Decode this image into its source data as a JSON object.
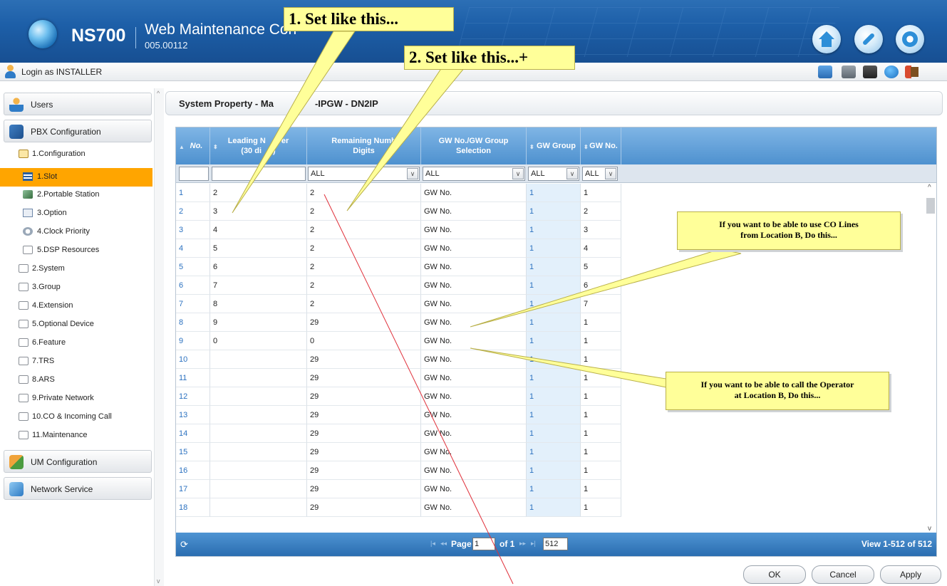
{
  "header": {
    "product": "NS700",
    "app_title": "Web Maintenance Con",
    "version": "005.00112",
    "login_label": "Login as INSTALLER",
    "top_icons": [
      "home-icon",
      "wrench-icon",
      "gear-icon"
    ],
    "toolbar_icons": [
      "calendar-icon",
      "phone-icon",
      "save-icon",
      "info-icon",
      "exit-icon"
    ]
  },
  "sidebar": {
    "sections": [
      {
        "label": "Users",
        "icon": "users-icon"
      },
      {
        "label": "PBX Configuration",
        "icon": "pbx-icon"
      },
      {
        "label": "UM Configuration",
        "icon": "um-icon"
      },
      {
        "label": "Network Service",
        "icon": "network-icon"
      }
    ],
    "tree": [
      {
        "label": "1.Configuration"
      },
      {
        "label": "1.Slot"
      },
      {
        "label": "2.Portable Station"
      },
      {
        "label": "3.Option"
      },
      {
        "label": "4.Clock Priority"
      },
      {
        "label": "5.DSP Resources"
      },
      {
        "label": "2.System"
      },
      {
        "label": "3.Group"
      },
      {
        "label": "4.Extension"
      },
      {
        "label": "5.Optional Device"
      },
      {
        "label": "6.Feature"
      },
      {
        "label": "7.TRS"
      },
      {
        "label": "8.ARS"
      },
      {
        "label": "9.Private Network"
      },
      {
        "label": "10.CO & Incoming Call"
      },
      {
        "label": "11.Maintenance"
      }
    ]
  },
  "main": {
    "title": "System Property - Ma",
    "title_tail": "-IPGW - DN2IP"
  },
  "grid": {
    "columns": [
      {
        "label": "No.",
        "sort": "▲"
      },
      {
        "label": "Leading N",
        "label2": "er",
        "sub": "(30 di",
        "sub2": ")",
        "sort": "⬍"
      },
      {
        "label": "Remaining Numb",
        "sub": "Digits",
        "sort": ""
      },
      {
        "label": "GW No./GW Group",
        "sub": "Selection",
        "sort": ""
      },
      {
        "label": "GW Group",
        "sort": "⬍"
      },
      {
        "label": "GW No.",
        "sort": "⬍"
      }
    ],
    "filters": {
      "remaining": "ALL",
      "selection": "ALL",
      "gw_group": "ALL",
      "gw_no": "ALL"
    },
    "rows": [
      {
        "no": "1",
        "leading": "2",
        "remaining": "2",
        "selection": "GW No.",
        "gw_group": "1",
        "gw_no": "1"
      },
      {
        "no": "2",
        "leading": "3",
        "remaining": "2",
        "selection": "GW No.",
        "gw_group": "1",
        "gw_no": "2"
      },
      {
        "no": "3",
        "leading": "4",
        "remaining": "2",
        "selection": "GW No.",
        "gw_group": "1",
        "gw_no": "3"
      },
      {
        "no": "4",
        "leading": "5",
        "remaining": "2",
        "selection": "GW No.",
        "gw_group": "1",
        "gw_no": "4"
      },
      {
        "no": "5",
        "leading": "6",
        "remaining": "2",
        "selection": "GW No.",
        "gw_group": "1",
        "gw_no": "5"
      },
      {
        "no": "6",
        "leading": "7",
        "remaining": "2",
        "selection": "GW No.",
        "gw_group": "1",
        "gw_no": "6"
      },
      {
        "no": "7",
        "leading": "8",
        "remaining": "2",
        "selection": "GW No.",
        "gw_group": "1",
        "gw_no": "7"
      },
      {
        "no": "8",
        "leading": "9",
        "remaining": "29",
        "selection": "GW No.",
        "gw_group": "1",
        "gw_no": "1"
      },
      {
        "no": "9",
        "leading": "0",
        "remaining": "0",
        "selection": "GW No.",
        "gw_group": "1",
        "gw_no": "1"
      },
      {
        "no": "10",
        "leading": "",
        "remaining": "29",
        "selection": "GW No.",
        "gw_group": "1",
        "gw_no": "1"
      },
      {
        "no": "11",
        "leading": "",
        "remaining": "29",
        "selection": "GW No.",
        "gw_group": "1",
        "gw_no": "1"
      },
      {
        "no": "12",
        "leading": "",
        "remaining": "29",
        "selection": "GW No.",
        "gw_group": "1",
        "gw_no": "1"
      },
      {
        "no": "13",
        "leading": "",
        "remaining": "29",
        "selection": "GW No.",
        "gw_group": "1",
        "gw_no": "1"
      },
      {
        "no": "14",
        "leading": "",
        "remaining": "29",
        "selection": "GW No.",
        "gw_group": "1",
        "gw_no": "1"
      },
      {
        "no": "15",
        "leading": "",
        "remaining": "29",
        "selection": "GW No.",
        "gw_group": "1",
        "gw_no": "1"
      },
      {
        "no": "16",
        "leading": "",
        "remaining": "29",
        "selection": "GW No.",
        "gw_group": "1",
        "gw_no": "1"
      },
      {
        "no": "17",
        "leading": "",
        "remaining": "29",
        "selection": "GW No.",
        "gw_group": "1",
        "gw_no": "1"
      },
      {
        "no": "18",
        "leading": "",
        "remaining": "29",
        "selection": "GW No.",
        "gw_group": "1",
        "gw_no": "1"
      }
    ],
    "pager": {
      "page_label": "Page",
      "page_value": "1",
      "of_label": "of 1",
      "page_size": "512",
      "view_text": "View 1-512 of 512"
    }
  },
  "buttons": {
    "ok": "OK",
    "cancel": "Cancel",
    "apply": "Apply"
  },
  "callouts": {
    "c1": "1. Set like this...",
    "c2": "2. Set like this...+",
    "note1_line1": "If you want to be able to use CO Lines",
    "note1_line2": "from Location B, Do this...",
    "note2_line1": "If you want to be able to call the Operator",
    "note2_line2": "at Location B, Do this..."
  },
  "colors": {
    "header_blue": "#1d5fa8",
    "selected_item": "#ffa500",
    "grid_header": "#5a9ad5",
    "callout_yellow": "#ffff99",
    "annotation_line": "#e0303a"
  }
}
